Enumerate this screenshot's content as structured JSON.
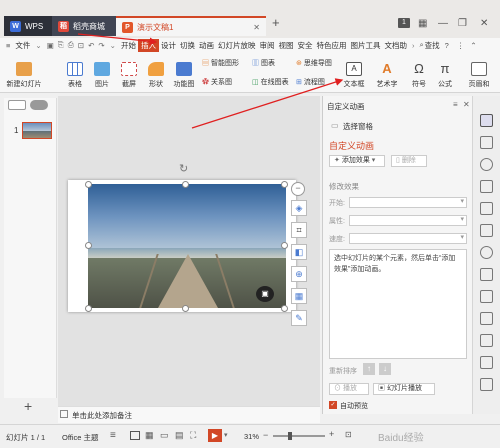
{
  "tabs": [
    {
      "label": "WPS"
    },
    {
      "label": "稻壳商城"
    },
    {
      "label": "演示文稿1"
    }
  ],
  "window": {
    "badge": "1"
  },
  "menubar": {
    "file": "文件",
    "items": [
      "开始",
      "插入",
      "设计",
      "切换",
      "动画",
      "幻灯片放映",
      "审阅",
      "视图",
      "安全",
      "特色应用",
      "图片工具",
      "文档助"
    ],
    "search": "查找"
  },
  "ribbon": {
    "new_slide": "新建幻灯片",
    "table": "表格",
    "picture": "图片",
    "screenshot": "截屏",
    "shape": "形状",
    "icon_lib": "功能图",
    "smart_graphic": "智能图形",
    "chart": "图表",
    "relation": "关系图",
    "mindmap": "思维导图",
    "online_chart": "在线图表",
    "flowchart": "流程图",
    "textbox": "文本框",
    "art_text": "艺术字",
    "symbol": "符号",
    "formula": "公式",
    "header_footer": "页眉和"
  },
  "leftpane": {
    "slide_num": "1"
  },
  "notes": {
    "placeholder": "单击此处添加备注"
  },
  "taskpane": {
    "title": "自定义动画",
    "select_pane": "选择窗格",
    "section_title": "自定义动画",
    "add_effect": "添加效果",
    "delete": "删除",
    "modify_label": "修改效果",
    "start": "开始:",
    "property": "属性:",
    "speed": "速度:",
    "hint": "选中幻灯片的某个元素，然后单击“添加效果”添加动画。",
    "reorder": "重新排序",
    "play": "播放",
    "slideshow": "幻灯片播放",
    "autopreview": "自动预览",
    "autopreview_checked": true
  },
  "statusbar": {
    "slide_info": "幻灯片 1 / 1",
    "theme": "Office 主题",
    "zoom": "31%",
    "zoom_level": 0.31,
    "watermark": "Baidu经验"
  },
  "colors": {
    "accent": "#d24726",
    "titlebar": "#ebe9e7",
    "ribbon": "#f7f7f7"
  }
}
